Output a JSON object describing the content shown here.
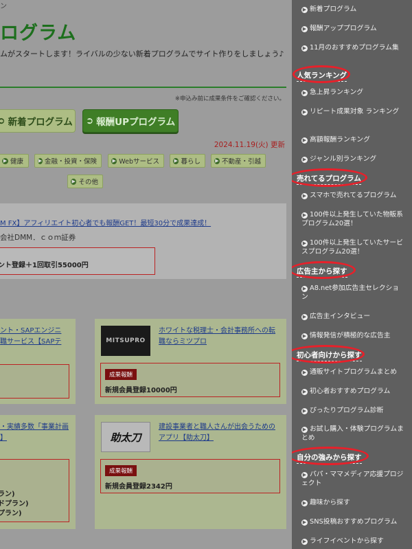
{
  "header": {
    "top_fragment": "ン",
    "title": "ログラム",
    "subtitle": "ムがスタートします！ライバルの少ない新着プログラムでサイト作りをしましょう♪",
    "notice": "※申込み前に成果条件をご確認ください。"
  },
  "buttons": {
    "new_programs": "新着プログラム",
    "reward_up": "報酬UPプログラム"
  },
  "date": {
    "value": "2024.11.19(火)",
    "suffix": "更新"
  },
  "categories": [
    "健康",
    "金融・投資・保険",
    "Webサービス",
    "暮らし",
    "不動産・引越",
    "その他"
  ],
  "feature": {
    "link": "M FX】アフィリエイト初心者でも報酬GET！最短30分で成果達成！",
    "company": "会社DMM．ｃｏｍ証券",
    "reward": "ント登録＋1回取引55000円"
  },
  "cards": {
    "c1": {
      "line1": "ント・SAPエンジニ",
      "line2": "職サービス【SAPテ"
    },
    "c2": {
      "logo": "MITSUPRO",
      "line1": "ホワイトな税理士・会計事務所への転",
      "line2": "職ならミツプロ",
      "badge": "成果報酬",
      "reward": "新規会員登録10000円"
    },
    "c3": {
      "line1": "・実績多数「事業計画",
      "line2": "】",
      "r1": "ラン)",
      "r2": "ドプラン)",
      "r3": "プラン)"
    },
    "c4": {
      "logo": "助太刀",
      "line1": "建設事業者と職人さんが出会うための",
      "line2": "アプリ【助太刀】",
      "badge": "成果報酬",
      "reward": "新規会員登録2342円"
    }
  },
  "sidebar": {
    "items_top": [
      "新着プログラム",
      "報酬アッププログラム",
      "11月のおすすめプログラム集"
    ],
    "head_ranking": "人気ランキング",
    "ranking": [
      "急上昇ランキング",
      "リピート成果対象 ランキング",
      "高額報酬ランキング",
      "ジャンル別ランキング"
    ],
    "head_selling": "売れてるプログラム",
    "selling": [
      "スマホで売れてるプログラム",
      "100件以上発生していた物販系プログラム20選！",
      "100件以上発生していたサービスプログラム20選！"
    ],
    "head_advertiser": "広告主から探す",
    "advertiser": [
      "A8.net参加広告主セレクション",
      "広告主インタビュー",
      "情報発信が積極的な広告主"
    ],
    "head_beginner": "初心者向けから探す",
    "beginner": [
      "通販サイトプログラムまとめ",
      "初心者おすすめプログラム",
      "ぴったりプログラム診断",
      "お試し購入・体験プログラムまとめ"
    ],
    "head_strength": "自分の強みから探す",
    "strength": [
      "パパ・ママメディア応援プロジェクト",
      "趣味から探す",
      "SNS投稿おすすめプログラム",
      "ライフイベントから探す"
    ]
  }
}
